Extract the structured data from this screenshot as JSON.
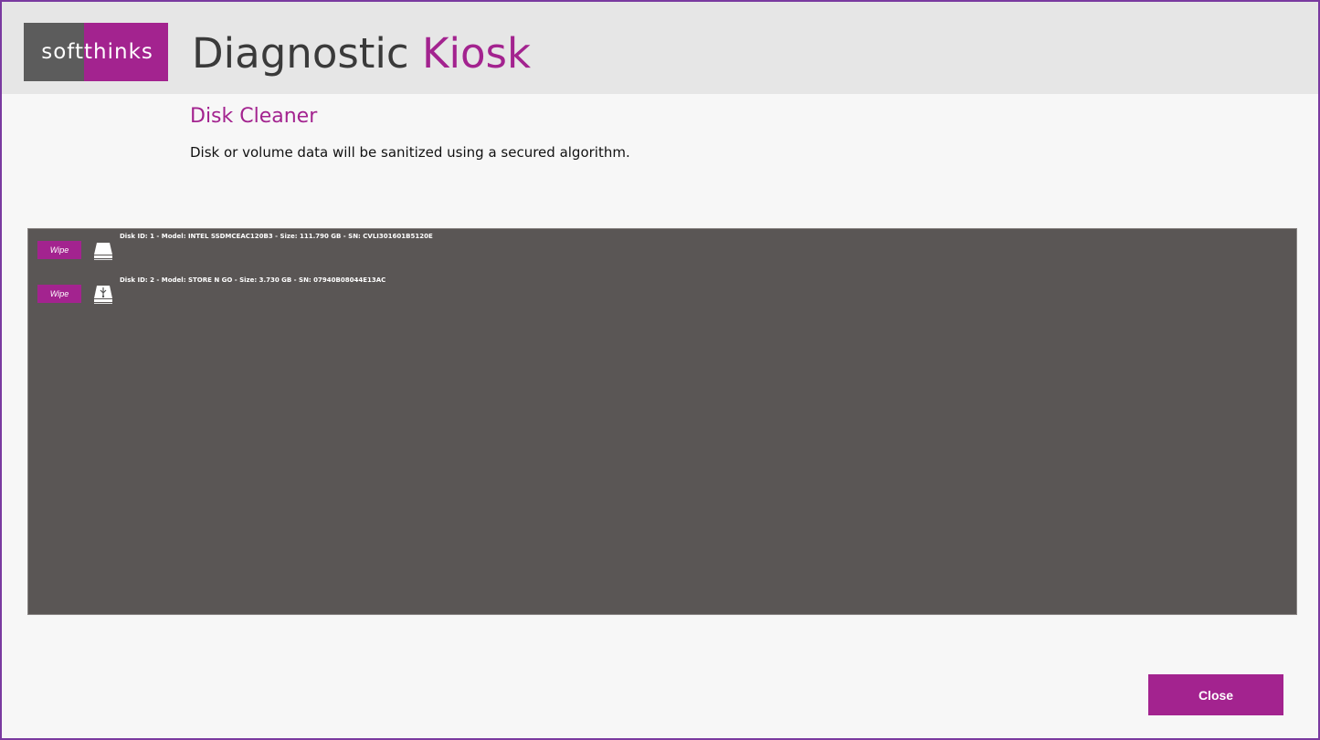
{
  "header": {
    "logo_left": "soft",
    "logo_right": "thinks",
    "title_main": "Diagnostic",
    "title_accent": "Kiosk"
  },
  "section": {
    "title": "Disk Cleaner",
    "description": "Disk or volume data will be sanitized using a secured algorithm."
  },
  "disks": [
    {
      "info": "Disk ID: 1 - Model: INTEL SSDMCEAC120B3 - Size: 111.790 GB - SN: CVLI301601B5120E",
      "action": "Wipe",
      "icon": "hard-drive-icon"
    },
    {
      "info": "Disk ID: 2 - Model: STORE N GO - Size: 3.730 GB - SN: 07940B08044E13AC",
      "action": "Wipe",
      "icon": "usb-drive-icon"
    }
  ],
  "footer": {
    "close_label": "Close"
  },
  "colors": {
    "accent": "#a3238f",
    "panel": "#5a5655",
    "header": "#e6e6e6"
  }
}
